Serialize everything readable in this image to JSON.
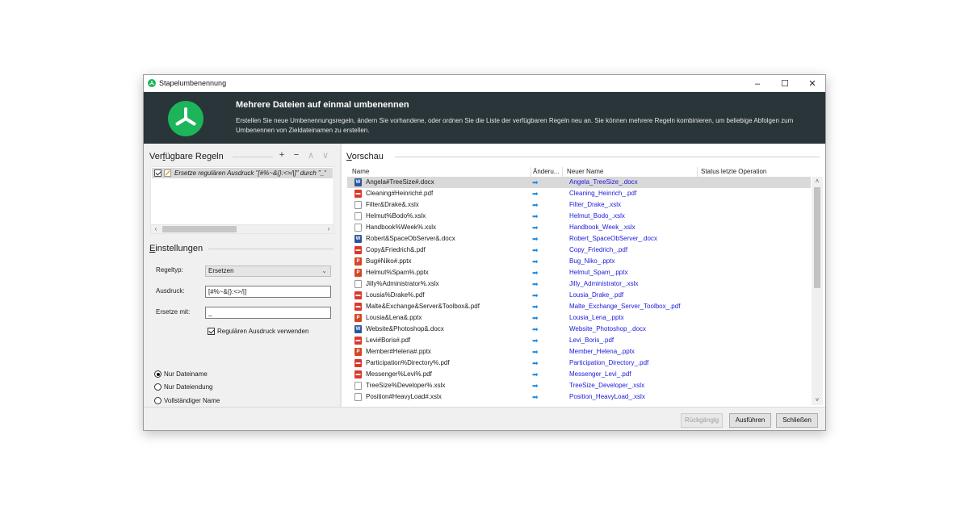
{
  "window": {
    "title": "Stapelumbenennung",
    "minimize_label": "–",
    "maximize_label": "☐",
    "close_label": "✕"
  },
  "banner": {
    "heading": "Mehrere Dateien auf einmal umbenennen",
    "description": "Erstellen Sie neue Umbenennungsregeln, ändern Sie vorhandene, oder ordnen Sie die Liste der verfügbaren Regeln neu an. Sie können mehrere Regeln kombinieren, um beliebige Abfolgen zum Umbenennen von Zieldateinamen zu erstellen.",
    "logo_color": "#1db55a"
  },
  "rules": {
    "title_prefix": "Ver",
    "title_underlined": "f",
    "title_suffix": "ügbare Regeln",
    "add_label": "+",
    "remove_label": "−",
    "up_label": "∧",
    "down_label": "∨",
    "items": [
      {
        "text": "Ersetze regulären Ausdruck \"[#%~&{}:<>/|]\" durch \"_\"",
        "checked": true
      }
    ],
    "scroll_left": "‹",
    "scroll_right": "›"
  },
  "settings": {
    "title_underlined": "E",
    "title_suffix": "instellungen",
    "rule_type_label": "Regeltyp:",
    "rule_type_value": "Ersetzen",
    "expression_label": "Ausdruck:",
    "expression_value": "[#%~&{}:<>/|]",
    "replace_label": "Ersetze mit:",
    "replace_value": "_",
    "regex_checkbox_label": "Regulären Ausdruck verwenden",
    "scope_options": [
      {
        "label": "Nur Dateiname",
        "selected": true
      },
      {
        "label": "Nur Dateiendung",
        "selected": false
      },
      {
        "label": "Vollständiger Name",
        "selected": false
      }
    ]
  },
  "preview": {
    "title_underlined": "V",
    "title_suffix": "orschau",
    "columns": [
      "Name",
      "Änderu...",
      "Neuer Name",
      "Status letzte Operation"
    ],
    "arrow_color": "#1e8be0",
    "rows": [
      {
        "icon": "docx",
        "name": "Angela#TreeSize#.docx",
        "new_name": "Angela_TreeSize_.docx",
        "selected": true
      },
      {
        "icon": "pdf",
        "name": "Cleaning#Heinrich#.pdf",
        "new_name": "Cleaning_Heinrich_.pdf"
      },
      {
        "icon": "xlsx",
        "name": "Filter&Drake&.xslx",
        "new_name": "Filter_Drake_.xslx"
      },
      {
        "icon": "xlsx",
        "name": "Helmut%Bodo%.xslx",
        "new_name": "Helmut_Bodo_.xslx"
      },
      {
        "icon": "xlsx",
        "name": "Handbook%Week%.xslx",
        "new_name": "Handbook_Week_.xslx"
      },
      {
        "icon": "docx",
        "name": "Robert&SpaceObServer&.docx",
        "new_name": "Robert_SpaceObServer_.docx"
      },
      {
        "icon": "pdf",
        "name": "Copy&Friedrich&.pdf",
        "new_name": "Copy_Friedrich_.pdf"
      },
      {
        "icon": "pptx",
        "name": "Bug#Niko#.pptx",
        "new_name": "Bug_Niko_.pptx"
      },
      {
        "icon": "pptx",
        "name": "Helmut%Spam%.pptx",
        "new_name": "Helmut_Spam_.pptx"
      },
      {
        "icon": "xlsx",
        "name": "Jilly%Administrator%.xslx",
        "new_name": "Jilly_Administrator_.xslx"
      },
      {
        "icon": "pdf",
        "name": "Lousia%Drake%.pdf",
        "new_name": "Lousia_Drake_.pdf"
      },
      {
        "icon": "pdf",
        "name": "Malte&Exchange&Server&Toolbox&.pdf",
        "new_name": "Malte_Exchange_Server_Toolbox_.pdf"
      },
      {
        "icon": "pptx",
        "name": "Lousia&Lena&.pptx",
        "new_name": "Lousia_Lena_.pptx"
      },
      {
        "icon": "docx",
        "name": "Website&Photoshop&.docx",
        "new_name": "Website_Photoshop_.docx"
      },
      {
        "icon": "pdf",
        "name": "Levi#Boris#.pdf",
        "new_name": "Levi_Boris_.pdf"
      },
      {
        "icon": "pptx",
        "name": "Member#Helena#.pptx",
        "new_name": "Member_Helena_.pptx"
      },
      {
        "icon": "pdf",
        "name": "Participation%Directory%.pdf",
        "new_name": "Participation_Directory_.pdf"
      },
      {
        "icon": "pdf",
        "name": "Messenger%Levi%.pdf",
        "new_name": "Messenger_Levi_.pdf"
      },
      {
        "icon": "xlsx",
        "name": "TreeSize%Developer%.xslx",
        "new_name": "TreeSize_Developer_.xslx"
      },
      {
        "icon": "xlsx",
        "name": "Position#HeavyLoad#.xslx",
        "new_name": "Position_HeavyLoad_.xslx"
      }
    ],
    "scroll_up": "˄",
    "scroll_down": "˅"
  },
  "footer": {
    "undo_label": "Rückgängig",
    "run_label": "Ausführen",
    "close_label": "Schließen"
  }
}
